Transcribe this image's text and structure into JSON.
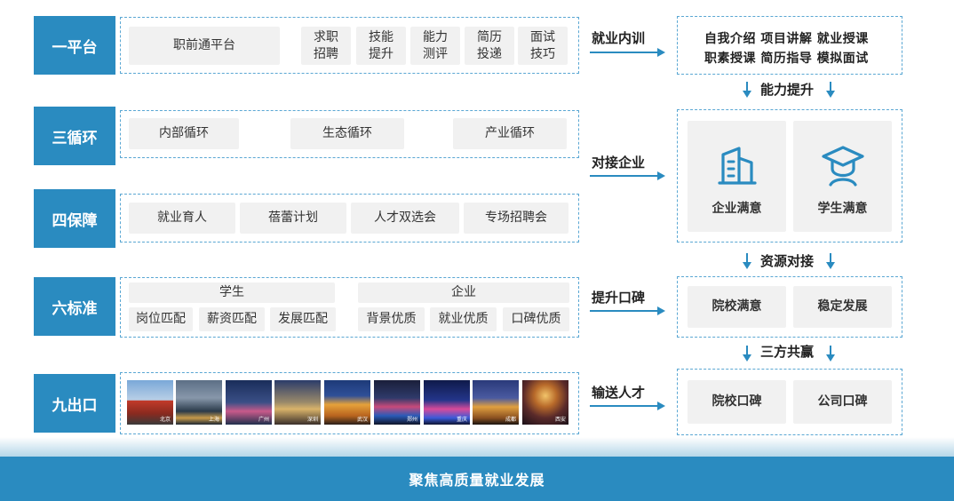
{
  "rows": {
    "r1": {
      "label": "一平台"
    },
    "r2": {
      "label": "三循环"
    },
    "r3": {
      "label": "四保障"
    },
    "r4": {
      "label": "六标准"
    },
    "r5": {
      "label": "九出口"
    }
  },
  "row1": {
    "platform": "职前通平台",
    "items": [
      "求职\n招聘",
      "技能\n提升",
      "能力\n测评",
      "简历\n投递",
      "面试\n技巧"
    ]
  },
  "row2": {
    "items": [
      "内部循环",
      "生态循环",
      "产业循环"
    ]
  },
  "row3": {
    "items": [
      "就业育人",
      "蓓蕾计划",
      "人才双选会",
      "专场招聘会"
    ]
  },
  "row4": {
    "student_header": "学生",
    "enterprise_header": "企业",
    "student_items": [
      "岗位匹配",
      "薪资匹配",
      "发展匹配"
    ],
    "enterprise_items": [
      "背景优质",
      "就业优质",
      "口碑优质"
    ]
  },
  "row5": {
    "cities": [
      "北京",
      "上海",
      "广州",
      "深圳",
      "武汉",
      "郑州",
      "重庆",
      "成都",
      "西安"
    ]
  },
  "middle": {
    "a1": "就业内训",
    "a2": "对接企业",
    "a3": "提升口碑",
    "a4": "输送人才"
  },
  "right": {
    "top_line1": "自我介绍 项目讲解 就业授课",
    "top_line2": "职素授课 简历指导 模拟面试",
    "step1": "能力提升",
    "enterprise_satisfaction": "企业满意",
    "student_satisfaction": "学生满意",
    "step2": "资源对接",
    "school_satisfaction": "院校满意",
    "stable_development": "稳定发展",
    "step3": "三方共赢",
    "school_reputation": "院校口碑",
    "company_reputation": "公司口碑"
  },
  "footer": {
    "text": "聚焦高质量就业发展"
  },
  "colors": {
    "accent": "#2a8bc0",
    "chip": "#f1f1f1",
    "dash": "#5aa7d3"
  },
  "icons": {
    "enterprise": "building-icon",
    "student": "graduate-icon"
  }
}
